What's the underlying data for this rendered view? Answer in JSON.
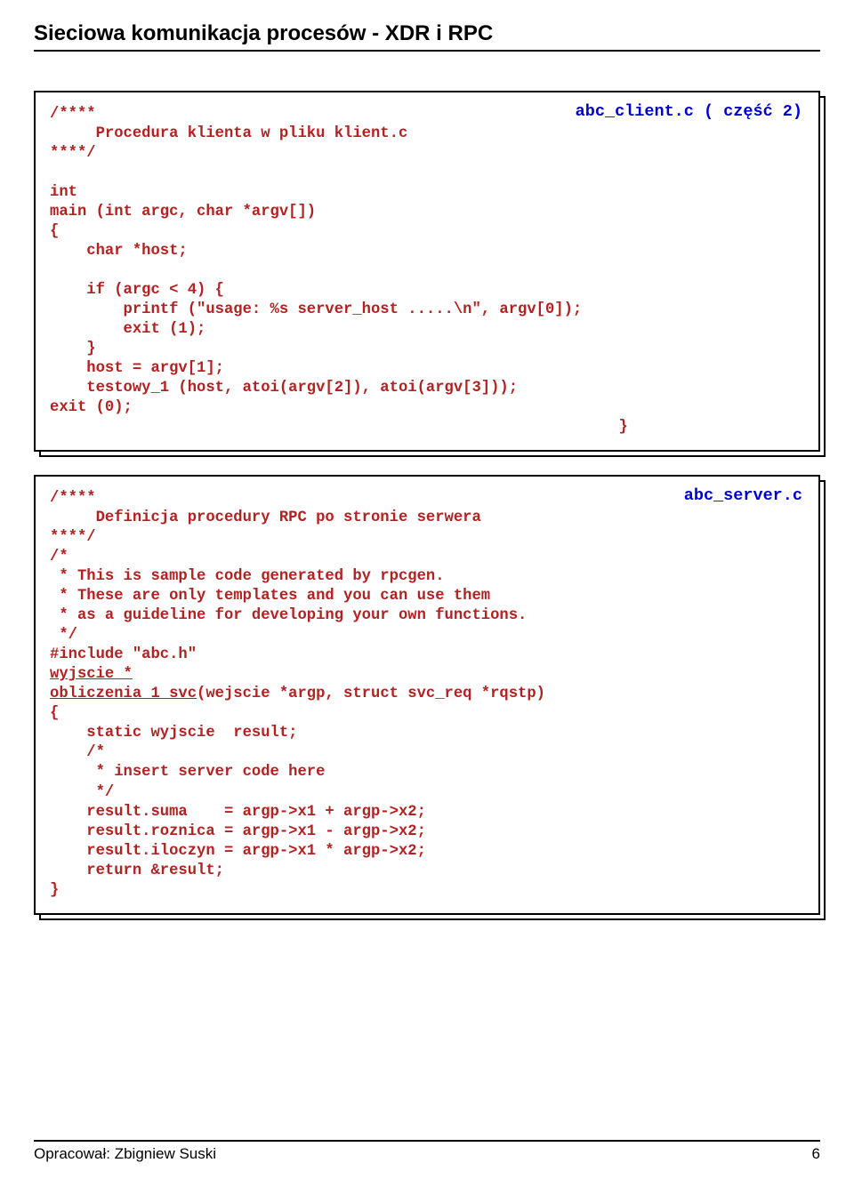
{
  "header": {
    "title": "Sieciowa komunikacja procesów - XDR i RPC"
  },
  "box1": {
    "label": "abc_client.c ( część 2)",
    "code": "/****\n     Procedura klienta w pliku klient.c\n****/\n\nint\nmain (int argc, char *argv[])\n{\n    char *host;\n\n    if (argc < 4) {\n        printf (\"usage: %s server_host .....\\n\", argv[0]);\n        exit (1);\n    }\n    host = argv[1];\n    testowy_1 (host, atoi(argv[2]), atoi(argv[3]));\nexit (0);\n                                                              }"
  },
  "box2": {
    "label": "abc_server.c",
    "code_part1": "/****\n     Definicja procedury RPC po stronie serwera\n****/\n/*\n * This is sample code generated by rpcgen.\n * These are only templates and you can use them\n * as a guideline for developing your own functions.\n */\n#include \"abc.h\"\n",
    "code_u1": "wyjscie *",
    "code_u2": "obliczenia_1_svc",
    "code_part2": "(wejscie *argp, struct svc_req *rqstp)\n{\n    static wyjscie  result;\n    /*\n     * insert server code here\n     */\n    result.suma    = argp->x1 + argp->x2;\n    result.roznica = argp->x1 - argp->x2;\n    result.iloczyn = argp->x1 * argp->x2;\n    return &result;\n}"
  },
  "footer": {
    "author": "Opracował: Zbigniew Suski",
    "page": "6"
  }
}
